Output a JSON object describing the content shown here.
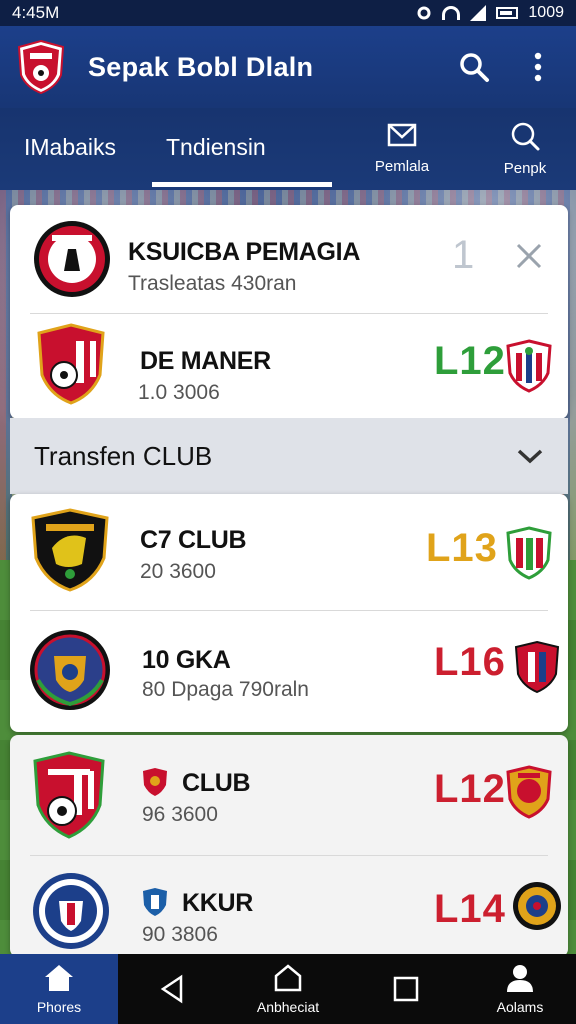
{
  "status_bar": {
    "time": "4:45M",
    "clock": "1009"
  },
  "app_bar": {
    "title": "Sepak Bobl Dlaln"
  },
  "tabs": {
    "tab1": "IMabaiks",
    "tab2": "Tndiensin",
    "tab3": "Pemlala",
    "tab4": "Penpk"
  },
  "top_card": {
    "row1": {
      "name": "KSUICBA PEMAGIA",
      "sub": "Trasleatas 430ran",
      "score": "1"
    },
    "row2": {
      "name": "DE MANER",
      "sub": "1.0 3006",
      "score": "L12"
    }
  },
  "section": {
    "title": "Transfen CLUB"
  },
  "club_card": {
    "row1": {
      "name": "C7 CLUB",
      "sub": "20 3600",
      "score": "L13"
    },
    "row2": {
      "name": "10 GKA",
      "sub": "80 Dpaga 790raln",
      "score": "L16"
    }
  },
  "lower_rows": {
    "row1": {
      "name": "CLUB",
      "sub": "96 3600",
      "score": "L12"
    },
    "row2": {
      "name": "KKUR",
      "sub": "90 3806",
      "score": "L14"
    }
  },
  "bottom_nav": {
    "home": "Phores",
    "center": "Anbheciat",
    "right": "Aolams"
  },
  "colors": {
    "green_score": "#2e9e3a",
    "yellow_score": "#e0a31a",
    "red_score": "#cc1f2f",
    "primary": "#1c3f8a"
  }
}
